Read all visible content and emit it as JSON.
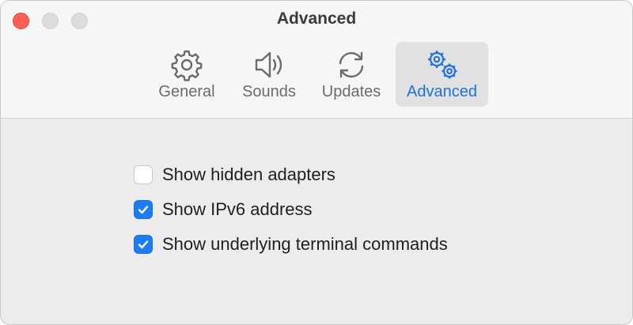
{
  "window": {
    "title": "Advanced"
  },
  "tabs": [
    {
      "label": "General",
      "icon": "gear-icon",
      "active": false
    },
    {
      "label": "Sounds",
      "icon": "speaker-icon",
      "active": false
    },
    {
      "label": "Updates",
      "icon": "refresh-icon",
      "active": false
    },
    {
      "label": "Advanced",
      "icon": "gears-icon",
      "active": true
    }
  ],
  "options": [
    {
      "label": "Show hidden adapters",
      "checked": false
    },
    {
      "label": "Show IPv6 address",
      "checked": true
    },
    {
      "label": "Show underlying terminal commands",
      "checked": true
    }
  ],
  "colors": {
    "accent": "#1c7cf5",
    "close_button": "#fe5f57",
    "inactive_icon": "#6b6b6b"
  }
}
